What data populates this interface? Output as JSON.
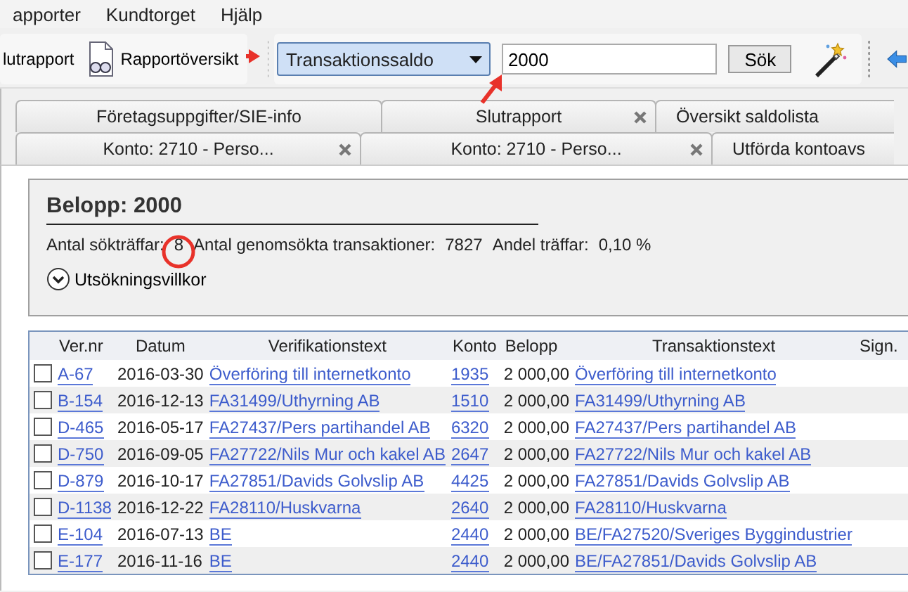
{
  "menu": [
    "apporter",
    "Kundtorget",
    "Hjälp"
  ],
  "toolbar": {
    "buttons": [
      {
        "label": "lutrapport",
        "kind": "text"
      },
      {
        "label": "Rapportöversikt",
        "kind": "report"
      }
    ],
    "search_type": {
      "value": "Transaktionssaldo"
    },
    "search": {
      "value": "2000"
    },
    "search_button": "Sök"
  },
  "tab_rows": [
    [
      {
        "label": "Företagsuppgifter/SIE-info",
        "closable": false,
        "selected": false
      },
      {
        "label": "Slutrapport",
        "closable": true,
        "selected": false
      },
      {
        "label": "Översikt saldolista",
        "closable": false,
        "selected": false
      }
    ],
    [
      {
        "label": "Konto: 2710 - Perso...",
        "closable": true,
        "selected": false
      },
      {
        "label": "Konto: 2710 - Perso...",
        "closable": true,
        "selected": false
      },
      {
        "label": "Utförda kontoavs",
        "closable": false,
        "selected": false
      }
    ]
  ],
  "summary": {
    "title": "Belopp: 2000",
    "stats": [
      {
        "label": "Antal sökträffar:",
        "value": "8"
      },
      {
        "label": "Antal genomsökta transaktioner:",
        "value": "7827"
      },
      {
        "label": "Andel träffar:",
        "value": "0,10 %"
      }
    ],
    "conditions": {
      "label": "Utsökningsvillkor",
      "expanded": false
    }
  },
  "table": {
    "columns": [
      "Ver.nr",
      "Datum",
      "Verifikationstext",
      "Konto",
      "Belopp",
      "Transaktionstext",
      "Sign."
    ],
    "rows": [
      {
        "checked": false,
        "ver": "A-67",
        "date": "2016-03-30",
        "vertext": "Överföring till internetkonto",
        "account": "1935",
        "amount": "2 000,00",
        "transtext": "Överföring till internetkonto"
      },
      {
        "checked": false,
        "ver": "B-154",
        "date": "2016-12-13",
        "vertext": "FA31499/Uthyrning AB",
        "account": "1510",
        "amount": "2 000,00",
        "transtext": "FA31499/Uthyrning AB"
      },
      {
        "checked": false,
        "ver": "D-465",
        "date": "2016-05-17",
        "vertext": "FA27437/Pers partihandel AB",
        "account": "6320",
        "amount": "2 000,00",
        "transtext": "FA27437/Pers partihandel AB"
      },
      {
        "checked": false,
        "ver": "D-750",
        "date": "2016-09-05",
        "vertext": "FA27722/Nils Mur och kakel AB",
        "account": "2647",
        "amount": "2 000,00",
        "transtext": "FA27722/Nils Mur och kakel AB"
      },
      {
        "checked": false,
        "ver": "D-879",
        "date": "2016-10-17",
        "vertext": "FA27851/Davids Golvslip AB",
        "account": "4425",
        "amount": "2 000,00",
        "transtext": "FA27851/Davids Golvslip AB"
      },
      {
        "checked": false,
        "ver": "D-1138",
        "date": "2016-12-22",
        "vertext": "FA28110/Huskvarna",
        "account": "2640",
        "amount": "2 000,00",
        "transtext": "FA28110/Huskvarna"
      },
      {
        "checked": false,
        "ver": "E-104",
        "date": "2016-07-13",
        "vertext": "BE",
        "account": "2440",
        "amount": "2 000,00",
        "transtext": "BE/FA27520/Sveriges Byggindustrier"
      },
      {
        "checked": false,
        "ver": "E-177",
        "date": "2016-11-16",
        "vertext": "BE",
        "account": "2440",
        "amount": "2 000,00",
        "transtext": "BE/FA27851/Davids Golvslip AB"
      }
    ]
  },
  "annotations": [
    {
      "kind": "arrow"
    },
    {
      "kind": "arrow"
    },
    {
      "kind": "circle"
    }
  ]
}
